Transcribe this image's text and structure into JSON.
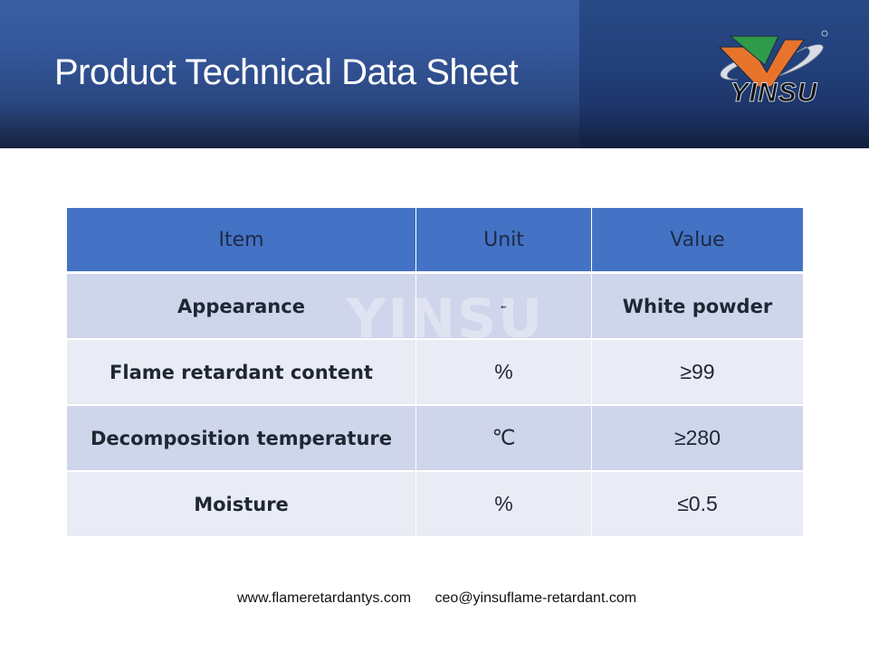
{
  "header": {
    "title": "Product Technical Data Sheet",
    "logo_text": "YINSU",
    "logo_colors": {
      "orange": "#e8742c",
      "green": "#2e9a4a",
      "silver": "#d9dde3"
    }
  },
  "table": {
    "columns": [
      "Item",
      "Unit",
      "Value"
    ],
    "rows": [
      {
        "item": "Appearance",
        "unit": "-",
        "value": "White powder"
      },
      {
        "item": "Flame retardant content",
        "unit": "%",
        "value": "≥99"
      },
      {
        "item": "Decomposition temperature",
        "unit": "℃",
        "value": "≥280"
      },
      {
        "item": "Moisture",
        "unit": "%",
        "value": "≤0.5"
      }
    ],
    "header_color": "#4472c4",
    "row_colors": [
      "#cfd5ea",
      "#e9ebf5"
    ]
  },
  "watermark": "YINSU",
  "footer": {
    "website": "www.flameretardantys.com",
    "email": "ceo@yinsuflame-retardant.com"
  }
}
